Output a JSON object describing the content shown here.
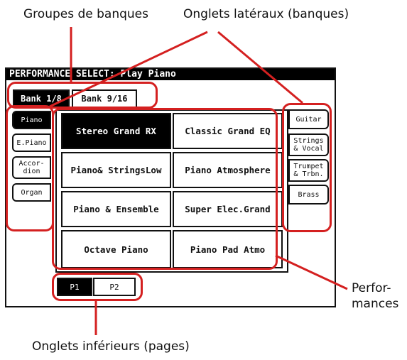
{
  "callouts": {
    "bank_groups": "Groupes de banques",
    "side_tabs": "Onglets latéraux (banques)",
    "performances_line1": "Perfor-",
    "performances_line2": "mances",
    "bottom_tabs": "Onglets inférieurs (pages)"
  },
  "screen": {
    "title": "PERFORMANCE SELECT: Play Piano",
    "bank_tabs": [
      {
        "label": "Bank 1/8",
        "selected": true
      },
      {
        "label": "Bank 9/16",
        "selected": false
      }
    ],
    "left_tabs": [
      {
        "line1": "Piano",
        "line2": "",
        "selected": true
      },
      {
        "line1": "E.Piano",
        "line2": "",
        "selected": false
      },
      {
        "line1": "Accor-",
        "line2": "dion",
        "selected": false
      },
      {
        "line1": "Organ",
        "line2": "",
        "selected": false
      }
    ],
    "right_tabs": [
      {
        "line1": "Guitar",
        "line2": ""
      },
      {
        "line1": "Strings",
        "line2": "& Vocal"
      },
      {
        "line1": "Trumpet",
        "line2": "& Trbn."
      },
      {
        "line1": "Brass",
        "line2": ""
      }
    ],
    "performances": [
      {
        "label": "Stereo Grand RX",
        "selected": true
      },
      {
        "label": "Classic Grand EQ",
        "selected": false
      },
      {
        "label": "Piano& StringsLow",
        "selected": false
      },
      {
        "label": "Piano Atmosphere",
        "selected": false
      },
      {
        "label": "Piano & Ensemble",
        "selected": false
      },
      {
        "label": "Super Elec.Grand",
        "selected": false
      },
      {
        "label": "Octave Piano",
        "selected": false
      },
      {
        "label": "Piano Pad Atmo",
        "selected": false
      }
    ],
    "page_tabs": [
      {
        "label": "P1",
        "selected": true
      },
      {
        "label": "P2",
        "selected": false
      }
    ]
  },
  "colors": {
    "highlight": "#d42020",
    "selected_bg": "#000000",
    "frame": "#111111"
  }
}
